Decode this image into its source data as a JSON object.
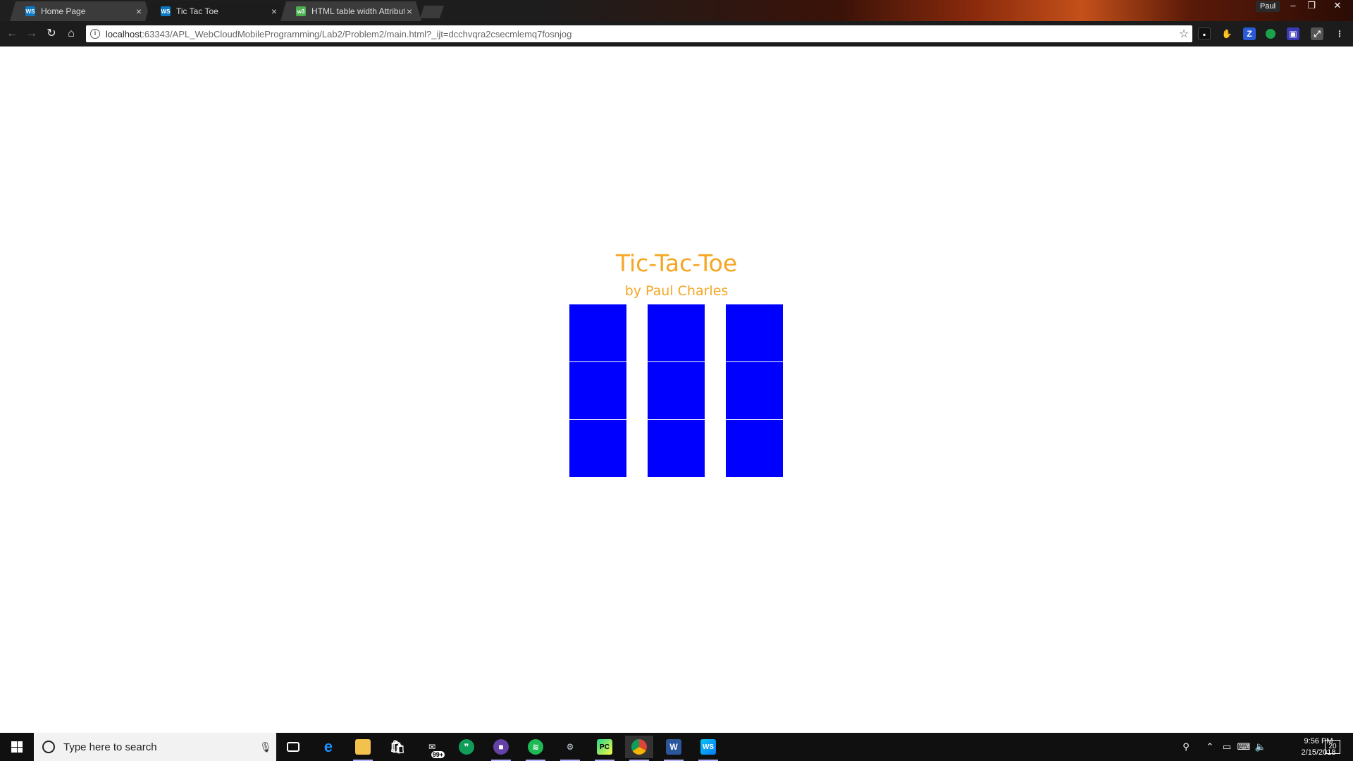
{
  "browser": {
    "tabs": [
      {
        "title": "Home Page",
        "favicon": "WS",
        "active": false
      },
      {
        "title": "Tic Tac Toe",
        "favicon": "WS",
        "active": true
      },
      {
        "title": "HTML table width Attribute",
        "favicon": "w3",
        "active": false
      }
    ],
    "profile_name": "Paul",
    "url_host": "localhost",
    "url_rest": ":63343/APL_WebCloudMobileProgramming/Lab2/Problem2/main.html?_ijt=dcchvqra2csecmlemq7fosnjog",
    "extension_icons": [
      "extension-1-icon",
      "extension-2-icon",
      "zotero-icon",
      "green-dot-icon",
      "extension-4-icon",
      "pdf-icon",
      "menu-icon"
    ]
  },
  "page": {
    "title": "Tic-Tac-Toe",
    "subtitle": "by Paul Charles",
    "board_color": "#0000ff",
    "title_color": "#f5a623",
    "cells": [
      "",
      "",
      "",
      "",
      "",
      "",
      "",
      "",
      ""
    ]
  },
  "taskbar": {
    "search_placeholder": "Type here to search",
    "pinned": [
      "task-view-icon",
      "edge-icon",
      "file-explorer-icon",
      "store-icon",
      "mail-icon",
      "hangouts-icon",
      "twitch-icon",
      "spotify-icon",
      "steam-icon",
      "pycharm-icon",
      "chrome-icon",
      "word-icon",
      "webstorm-icon"
    ],
    "mail_badge": "99+",
    "time": "9:56 PM",
    "date": "2/15/2018",
    "notification_count": "20"
  }
}
